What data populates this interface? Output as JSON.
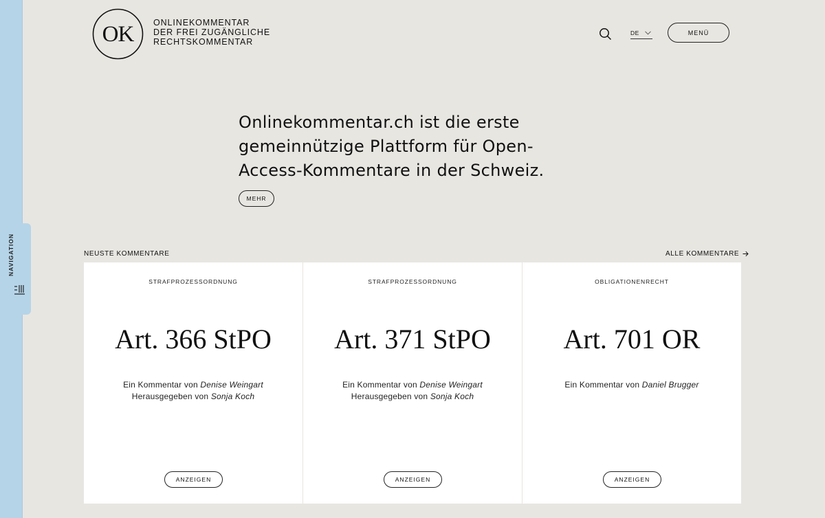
{
  "sidebar": {
    "label": "NAVIGATION",
    "icon": "menu-lines-icon"
  },
  "header": {
    "logo_text": "OK",
    "tagline": [
      "ONLINEKOMMENTAR",
      "DER FREI ZUGÄNGLICHE",
      "RECHTSKOMMENTAR"
    ],
    "search_icon": "search-icon",
    "language": "DE",
    "menu_label": "MENÜ"
  },
  "hero": {
    "text": "Onlinekommentar.ch ist die erste gemeinnützige Plattform für Open-Access-Kommentare in der Schweiz.",
    "more_label": "MEHR"
  },
  "section": {
    "title": "NEUSTE KOMMENTARE",
    "all_label": "ALLE KOMMENTARE"
  },
  "cards": [
    {
      "category": "STRAFPROZESSORDNUNG",
      "title": "Art. 366 StPO",
      "author_prefix": "Ein Kommentar von",
      "author": "Denise Weingart",
      "editor_prefix": "Herausgegeben von",
      "editor": "Sonja Koch",
      "button": "ANZEIGEN"
    },
    {
      "category": "STRAFPROZESSORDNUNG",
      "title": "Art. 371 StPO",
      "author_prefix": "Ein Kommentar von",
      "author": "Denise Weingart",
      "editor_prefix": "Herausgegeben von",
      "editor": "Sonja Koch",
      "button": "ANZEIGEN"
    },
    {
      "category": "OBLIGATIONENRECHT",
      "title": "Art. 701 OR",
      "author_prefix": "Ein Kommentar von",
      "author": "Daniel Brugger",
      "editor_prefix": "",
      "editor": "",
      "button": "ANZEIGEN"
    }
  ],
  "colors": {
    "background": "#e8e6e1",
    "sidebar": "#b5d4e8",
    "card": "#ffffff",
    "text": "#111111"
  }
}
